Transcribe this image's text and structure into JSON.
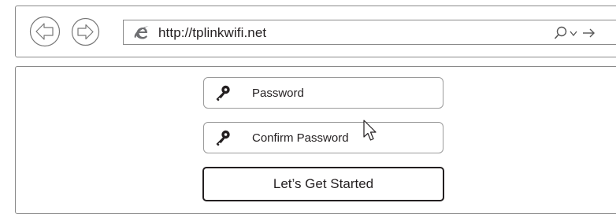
{
  "browser": {
    "url": "http://tplinkwifi.net",
    "back_icon": "back-arrow-icon",
    "forward_icon": "forward-arrow-icon",
    "browser_icon": "internet-explorer-icon",
    "search_icon": "search-icon",
    "dropdown_icon": "chevron-down-icon",
    "go_icon": "go-arrow-icon"
  },
  "form": {
    "password_label": "Password",
    "confirm_label": "Confirm Password",
    "field_icon": "key-icon",
    "submit_label": "Let’s Get Started"
  },
  "colors": {
    "text": "#231f20",
    "border": "#8a8a8a"
  }
}
